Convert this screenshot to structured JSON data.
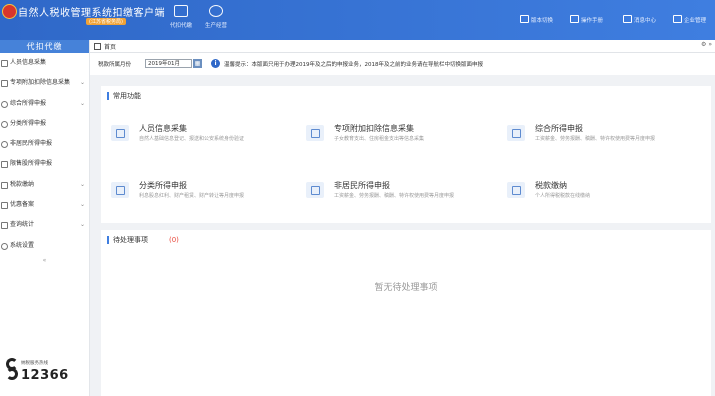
{
  "header": {
    "app_title": "自然人税收管理系统扣缴客户端",
    "app_subtitle": "(江苏省税务局)",
    "nav": [
      {
        "label": "代扣代缴",
        "icon": "building-icon"
      },
      {
        "label": "生产经营",
        "icon": "database-icon"
      }
    ],
    "right_links": [
      {
        "label": "版本切换",
        "icon": "switch-icon"
      },
      {
        "label": "操作手册",
        "icon": "manual-icon"
      },
      {
        "label": "消息中心",
        "icon": "message-icon"
      },
      {
        "label": "企业管理",
        "icon": "company-icon"
      }
    ]
  },
  "sidebar": {
    "title": "代扣代缴",
    "items": [
      {
        "label": "人员信息采集",
        "icon": "person-icon",
        "expandable": false
      },
      {
        "label": "专项附加扣除信息采集",
        "icon": "list-icon",
        "expandable": true
      },
      {
        "label": "综合所得申报",
        "icon": "gear-icon",
        "expandable": true
      },
      {
        "label": "分类所得申报",
        "icon": "gear-icon",
        "expandable": false
      },
      {
        "label": "非居民所得申报",
        "icon": "globe-icon",
        "expandable": false
      },
      {
        "label": "限售股所得申报",
        "icon": "stock-icon",
        "expandable": false
      },
      {
        "label": "税款缴纳",
        "icon": "payment-icon",
        "expandable": true
      },
      {
        "label": "优惠备案",
        "icon": "filing-icon",
        "expandable": true
      },
      {
        "label": "查询统计",
        "icon": "chart-icon",
        "expandable": true
      },
      {
        "label": "系统设置",
        "icon": "settings-icon",
        "expandable": false
      }
    ],
    "collapse_glyph": "«",
    "hotline_caption": "纳税服务热线",
    "hotline_number": "12366"
  },
  "tabs": {
    "home_label": "首页",
    "tools_glyph": "⚙ »"
  },
  "filter": {
    "period_label": "税款所属月份",
    "period_value": "2019年01月",
    "calendar_glyph": "▦",
    "info_glyph": "i",
    "tip": "温馨提示：本版面只用于办理2019年及之后的申报业务，2018年及之前的业务请在导航栏中切换版面申报"
  },
  "functions": {
    "title": "常用功能",
    "cards": [
      {
        "title": "人员信息采集",
        "desc": "自然人基础信息登记、报送和公安系统身份验证",
        "icon": "person-card-icon"
      },
      {
        "title": "专项附加扣除信息采集",
        "desc": "子女教育支出、住房租金支出等信息采集",
        "icon": "deduction-icon"
      },
      {
        "title": "综合所得申报",
        "desc": "工资薪金、劳务报酬、稿酬、特许权使用费等月度申报",
        "icon": "comprehensive-icon"
      },
      {
        "title": "分类所得申报",
        "desc": "利息股息红利、财产租赁、财产转让等月度申报",
        "icon": "classified-icon"
      },
      {
        "title": "非居民所得申报",
        "desc": "工资薪金、劳务报酬、稿酬、特许权使用费等月度申报",
        "icon": "nonresident-icon"
      },
      {
        "title": "税款缴纳",
        "desc": "个人所得税税款在线缴纳",
        "icon": "tax-payment-icon"
      }
    ]
  },
  "pending": {
    "title": "待处理事项",
    "count": "(0)",
    "empty_text": "暂无待处理事项"
  }
}
